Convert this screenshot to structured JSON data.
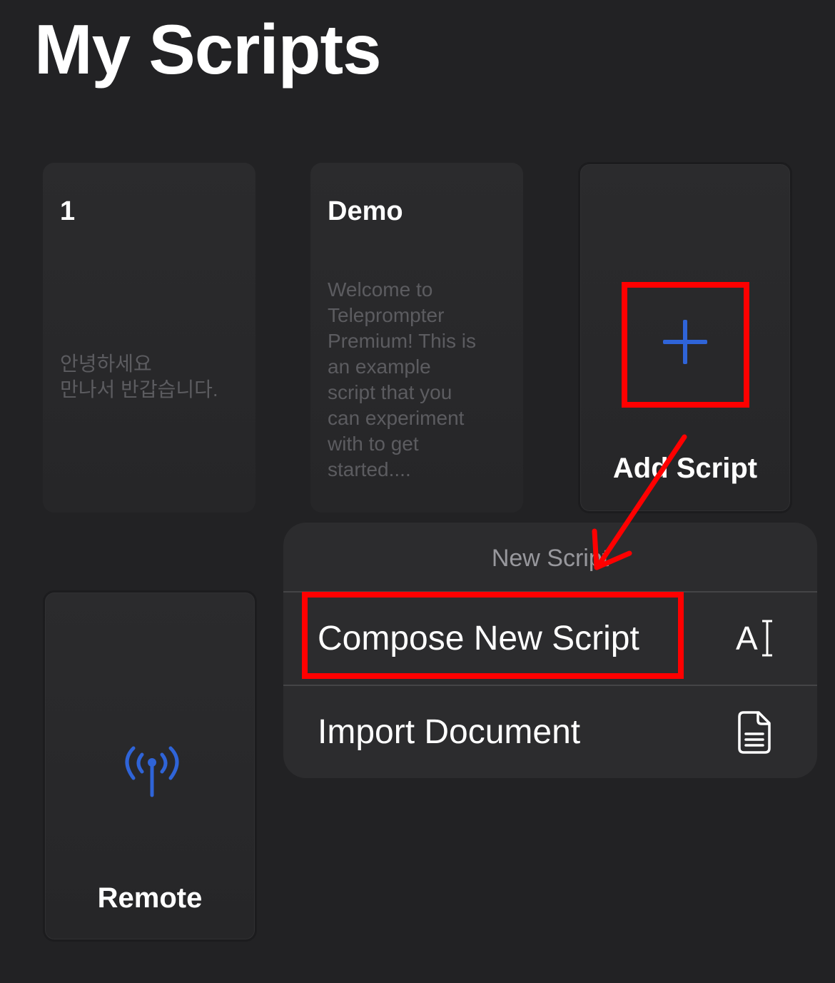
{
  "page": {
    "title": "My Scripts"
  },
  "cards": [
    {
      "title": "1",
      "preview": "안녕하세요\n만나서 반갑습니다."
    },
    {
      "title": "Demo",
      "preview": "Welcome to\nTeleprompter\nPremium! This is\nan example\nscript that you\ncan experiment\nwith to get\nstarted...."
    }
  ],
  "add_card": {
    "label": "Add Script",
    "icon": "plus-icon"
  },
  "remote_card": {
    "label": "Remote",
    "icon": "antenna-broadcast-icon"
  },
  "menu": {
    "header": "New Script",
    "items": [
      {
        "label": "Compose New Script",
        "icon": "text-cursor-icon",
        "icon_text": "A"
      },
      {
        "label": "Import Document",
        "icon": "document-icon"
      }
    ]
  },
  "colors": {
    "background": "#222224",
    "accent_blue": "#2f64d8",
    "annotation_red": "#ff0000",
    "menu_background": "#2c2c2e"
  }
}
